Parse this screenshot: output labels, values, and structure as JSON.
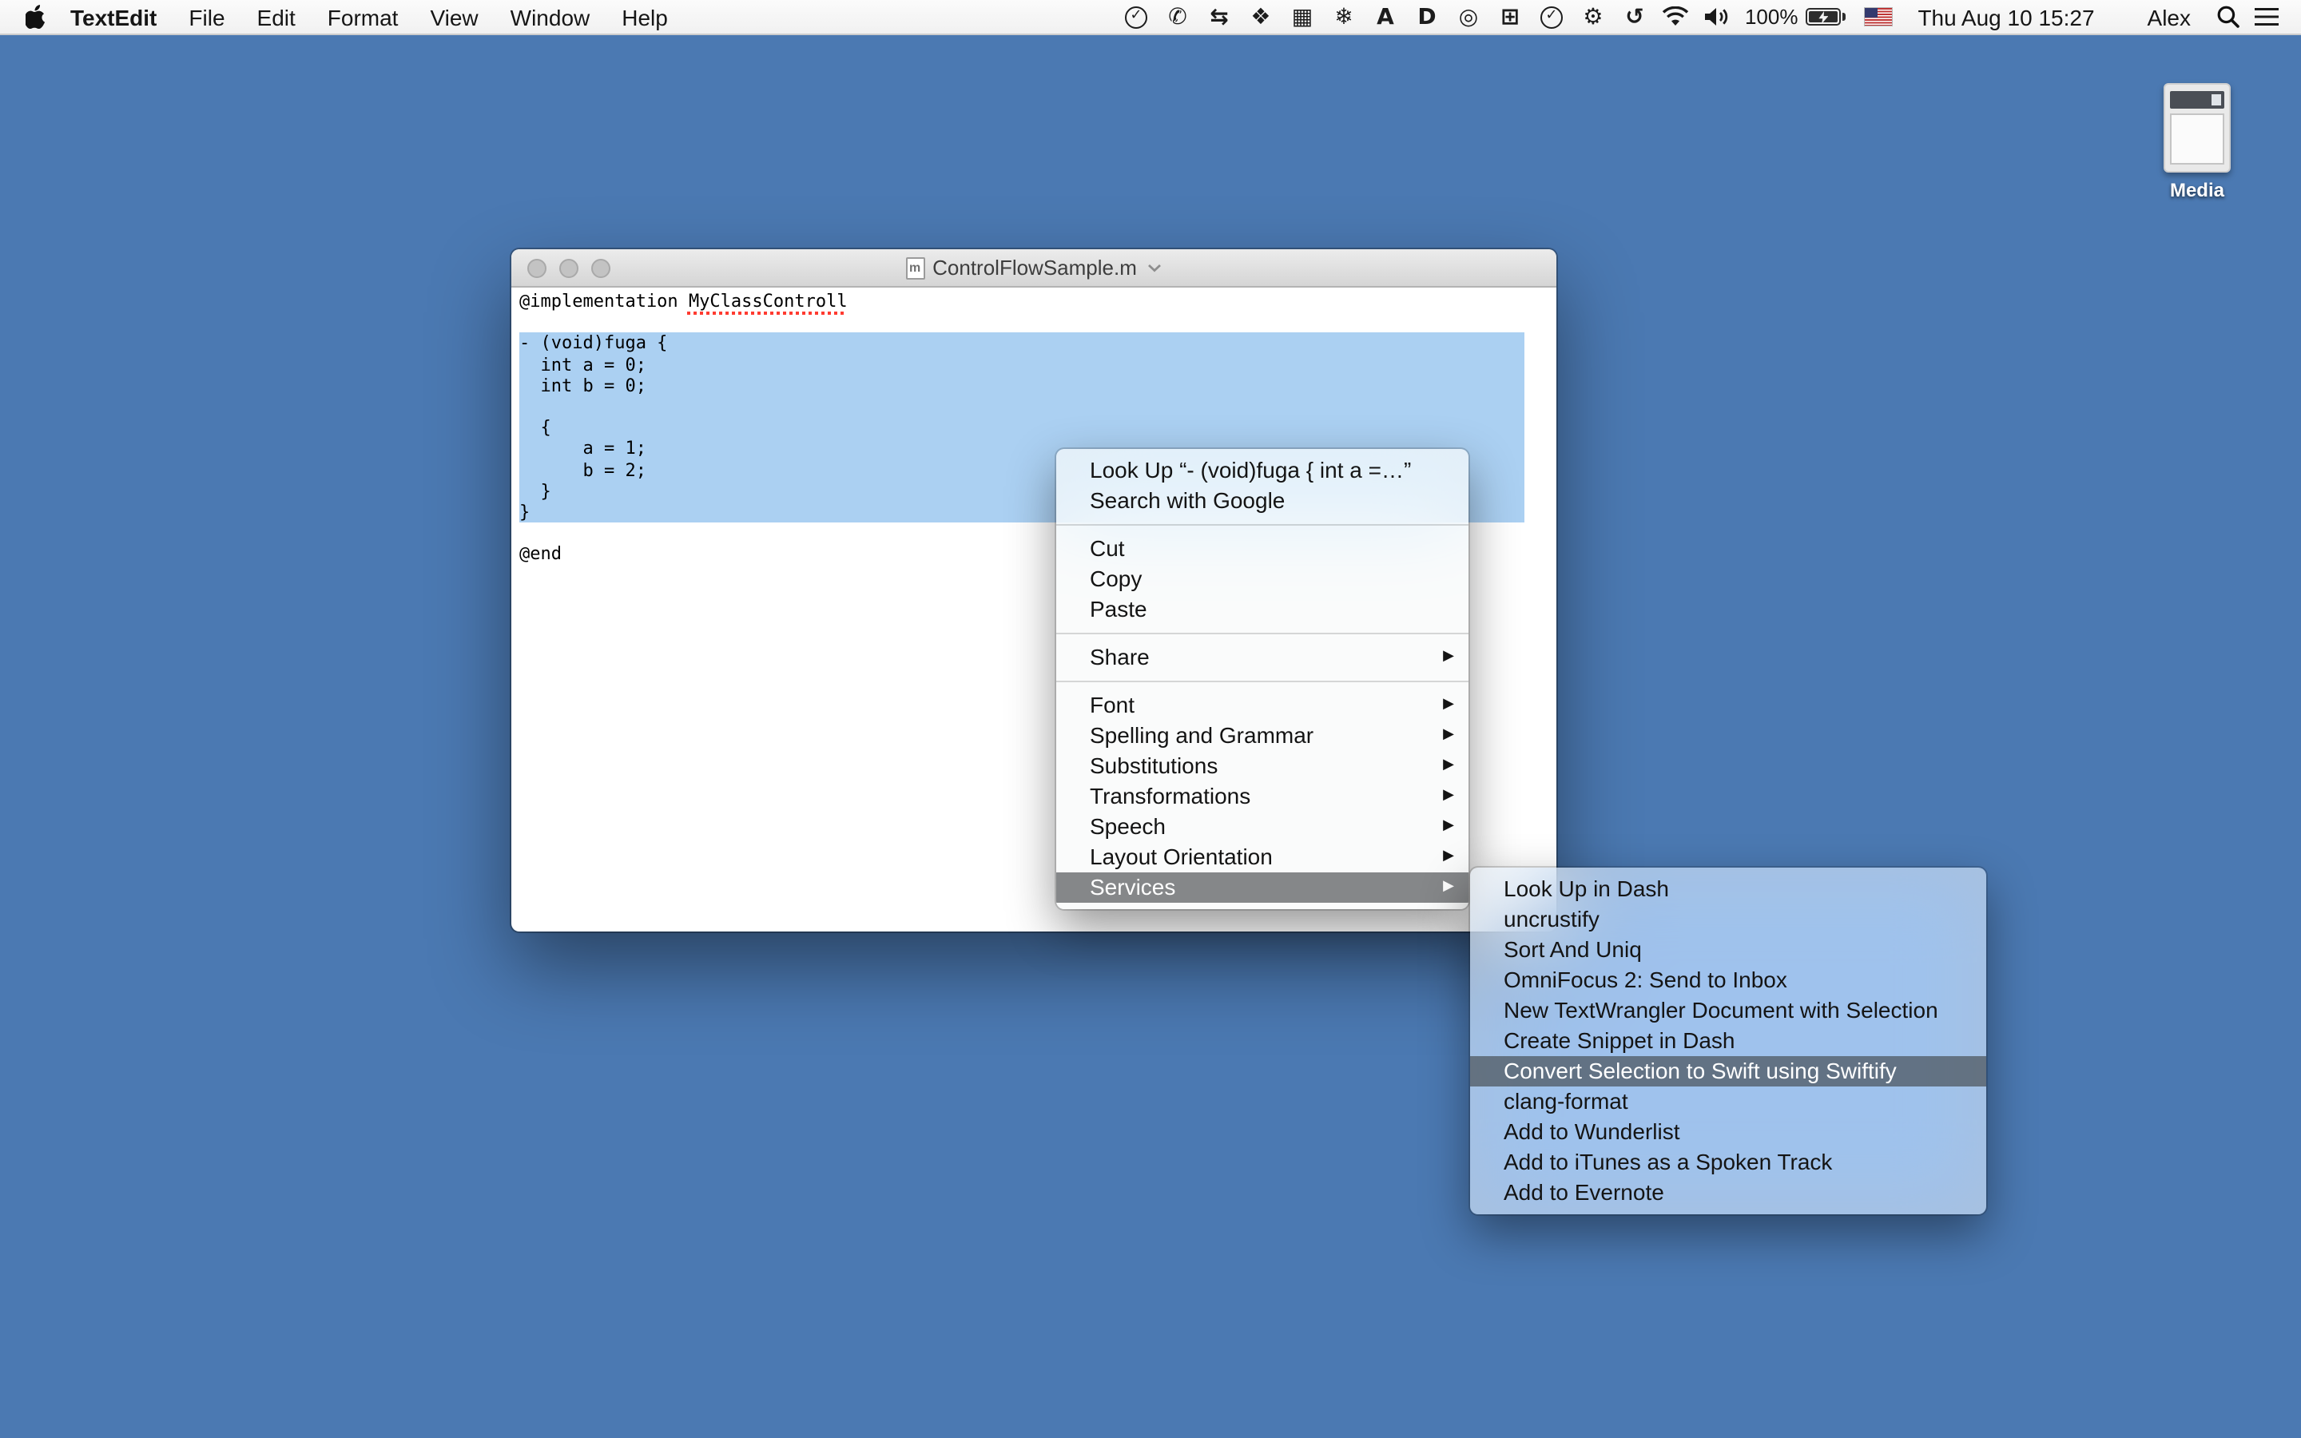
{
  "menu_bar": {
    "app_name": "TextEdit",
    "menus": [
      "File",
      "Edit",
      "Format",
      "View",
      "Window",
      "Help"
    ],
    "status_icons": [
      {
        "name": "task-check-icon",
        "glyph": "✓",
        "circle": true
      },
      {
        "name": "phone-icon",
        "glyph": "✆"
      },
      {
        "name": "sync-arrows-icon",
        "glyph": "⇆"
      },
      {
        "name": "app-diamond-icon",
        "glyph": "❖"
      },
      {
        "name": "keyboard-icon",
        "glyph": "▦"
      },
      {
        "name": "snowflake-icon",
        "glyph": "❄"
      },
      {
        "name": "letter-a-app-icon",
        "glyph": "A"
      },
      {
        "name": "dash-app-icon",
        "glyph": "D"
      },
      {
        "name": "target-icon",
        "glyph": "◎"
      },
      {
        "name": "grid-icon",
        "glyph": "⊞"
      },
      {
        "name": "check-circle-icon",
        "glyph": "✓",
        "circle": true
      },
      {
        "name": "gear-icon",
        "glyph": "⚙"
      },
      {
        "name": "time-machine-icon",
        "glyph": "↺"
      }
    ],
    "battery_percent": "100%",
    "clock": "Thu Aug 10 15:27",
    "user_name": "Alex"
  },
  "desktop": {
    "background_color": "#4b79b2",
    "icon_label": "Media"
  },
  "window": {
    "title": "ControlFlowSample.m",
    "doc_icon_letter": "m"
  },
  "editor": {
    "selection_color": "#abd0f2",
    "lines": [
      {
        "pre": "@implementation ",
        "spell_error": "MyClassControll"
      },
      {
        "text": ""
      },
      {
        "text": "- (void)fuga {",
        "selected": true
      },
      {
        "text": "  int a = 0;",
        "selected": true
      },
      {
        "text": "  int b = 0;",
        "selected": true
      },
      {
        "text": "",
        "selected": true
      },
      {
        "text": "  {",
        "selected": true
      },
      {
        "text": "      a = 1;",
        "selected": true
      },
      {
        "text": "      b = 2;",
        "selected": true
      },
      {
        "text": "  }",
        "selected": true
      },
      {
        "text": "}",
        "selected": true
      },
      {
        "text": ""
      },
      {
        "text": "@end"
      }
    ]
  },
  "context_menu": {
    "submenu_arrow": "▶",
    "items": [
      {
        "label": "Look Up “- (void)fuga {  int a =…”"
      },
      {
        "label": "Search with Google"
      },
      {
        "separator": true
      },
      {
        "label": "Cut"
      },
      {
        "label": "Copy"
      },
      {
        "label": "Paste"
      },
      {
        "separator": true
      },
      {
        "label": "Share",
        "submenu": true
      },
      {
        "separator": true
      },
      {
        "label": "Font",
        "submenu": true
      },
      {
        "label": "Spelling and Grammar",
        "submenu": true
      },
      {
        "label": "Substitutions",
        "submenu": true
      },
      {
        "label": "Transformations",
        "submenu": true
      },
      {
        "label": "Speech",
        "submenu": true
      },
      {
        "label": "Layout Orientation",
        "submenu": true
      },
      {
        "label": "Services",
        "submenu": true,
        "highlighted": true
      }
    ]
  },
  "services_menu": {
    "highlighted_item": "Convert Selection to Swift using Swiftify",
    "items": [
      {
        "label": "Look Up in Dash"
      },
      {
        "label": "uncrustify"
      },
      {
        "label": "Sort And Uniq"
      },
      {
        "label": "OmniFocus 2: Send to Inbox"
      },
      {
        "label": "New TextWrangler Document with Selection"
      },
      {
        "label": "Create Snippet in Dash"
      },
      {
        "label": "Convert Selection to Swift using Swiftify",
        "highlighted": true
      },
      {
        "label": "clang-format"
      },
      {
        "label": "Add to Wunderlist"
      },
      {
        "label": "Add to iTunes as a Spoken Track"
      },
      {
        "label": "Add to Evernote"
      }
    ]
  },
  "colors": {
    "desktop_blue": "#4b79b2",
    "text_selection_blue": "#abd0f2",
    "menu_highlight_gray": "#8c8c8c",
    "spellcheck_red": "#ff3b30"
  }
}
